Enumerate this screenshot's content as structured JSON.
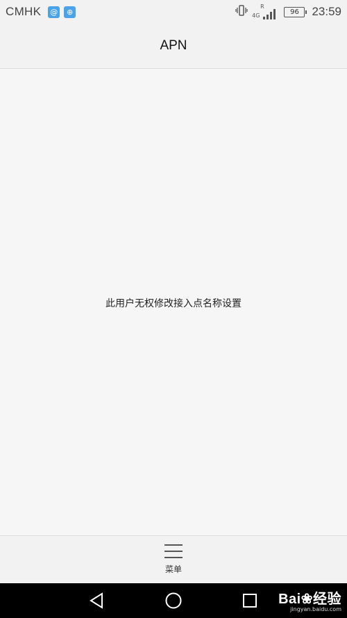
{
  "status_bar": {
    "carrier": "CMHK",
    "app_badges": [
      "@",
      "⊕"
    ],
    "vibrate_icon": "vibrate-icon",
    "network_type": "4G",
    "roaming": "R",
    "signal_level": 4,
    "battery": "96",
    "time": "23:59"
  },
  "header": {
    "title": "APN"
  },
  "main": {
    "message": "此用户无权修改接入点名称设置"
  },
  "bottom_bar": {
    "menu_icon": "menu-icon",
    "menu_label": "菜单"
  },
  "nav_bar": {
    "back_icon": "back-triangle-icon",
    "home_icon": "home-circle-icon",
    "recent_icon": "recent-square-icon"
  },
  "watermark": {
    "main": "Bai❀经验",
    "sub": "jingyan.baidu.com"
  }
}
